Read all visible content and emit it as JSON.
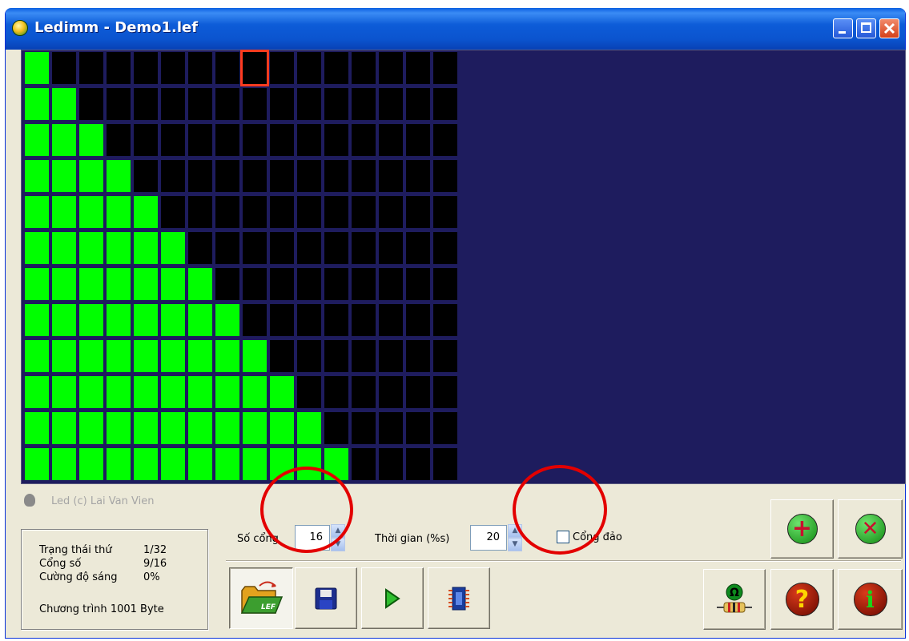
{
  "window": {
    "title": "Ledimm - Demo1.lef"
  },
  "led_matrix": {
    "columns": 16,
    "rows": 12,
    "lit_counts_per_row": [
      1,
      2,
      3,
      4,
      5,
      6,
      7,
      8,
      9,
      10,
      11,
      12
    ],
    "on_color": "#00ff00",
    "off_color": "#000000",
    "background_color": "#1e1c5e",
    "selected_cell": {
      "row": 1,
      "column": 9
    }
  },
  "credit": "Led (c) Lai Van Vien",
  "status": {
    "state_label": "Trạng thái thứ",
    "state_value": "1/32",
    "port_label": "Cổng số",
    "port_value": "9/16",
    "brightness_label": "Cường độ sáng",
    "brightness_value": "0%",
    "program_label": "Chương trình",
    "program_value": "1001 Byte"
  },
  "controls": {
    "ports_label": "Số cổng",
    "ports_value": "16",
    "time_label": "Thời gian (%s)",
    "time_value": "20",
    "invert_label": "Cổng đảo",
    "invert_checked": false
  },
  "toolbar": {
    "open": "folder-open-icon",
    "save": "floppy-disk-icon",
    "play": "play-icon",
    "chip": "chip-icon",
    "add": "add-icon",
    "remove": "remove-icon",
    "resistor": "resistor-icon",
    "help": "help-icon",
    "info": "info-icon"
  },
  "colors": {
    "accent_red": "#e30000",
    "window_face": "#ece9d8",
    "title_blue": "#0b54cf"
  }
}
